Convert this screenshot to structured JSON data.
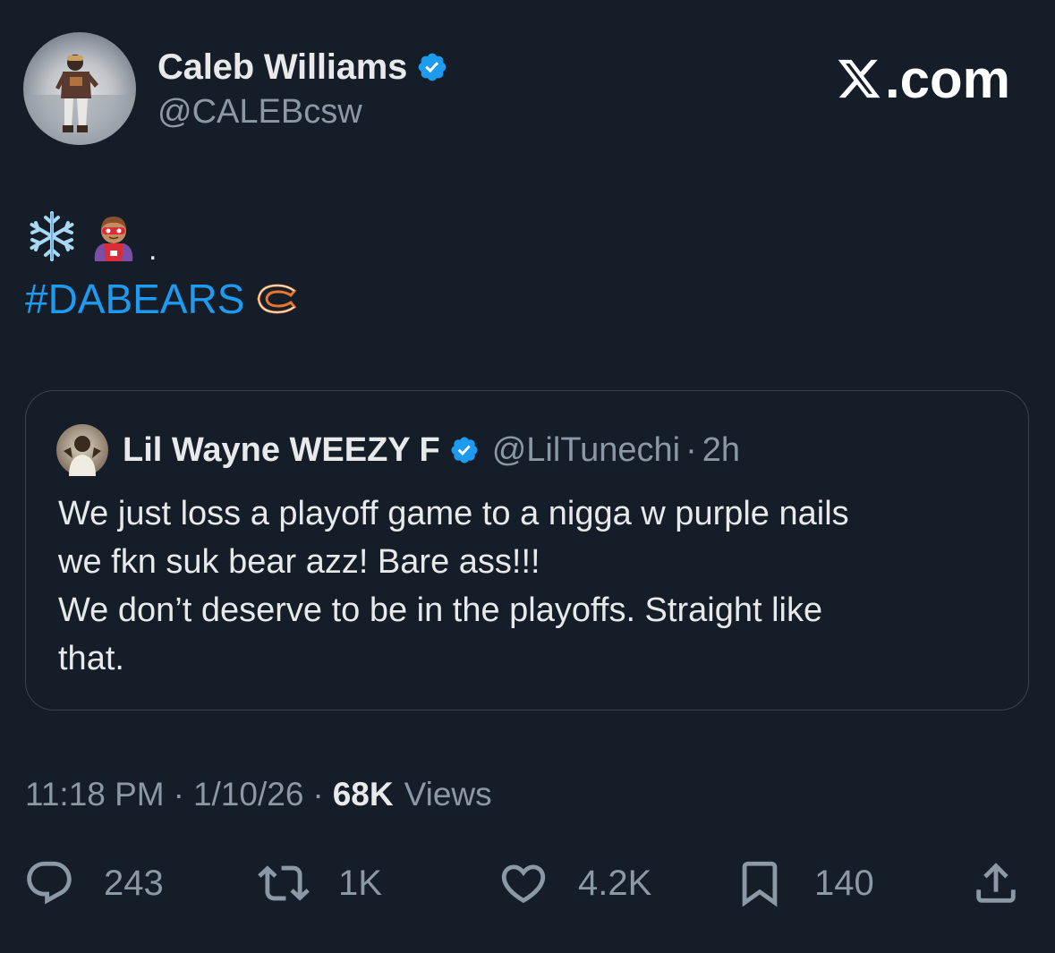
{
  "author": {
    "name": "Caleb Williams",
    "handle": "@CALEBcsw",
    "verified": true
  },
  "site_label": ".com",
  "tweet": {
    "emojis": [
      "snowflake",
      "superhero"
    ],
    "trailing_dot": ".",
    "hashtag": "#DABEARS"
  },
  "quote": {
    "name": "Lil Wayne WEEZY F",
    "handle": "@LilTunechi",
    "separator": "·",
    "time": "2h",
    "lines": [
      "We just loss a playoff game to a nigga w purple nails",
      "we fkn suk bear azz! Bare ass!!!",
      "We don’t deserve to be in the playoffs. Straight like",
      "that."
    ]
  },
  "meta": {
    "time": "11:18 PM",
    "separator": "·",
    "date": "1/10/26",
    "views_count": "68K",
    "views_label": "Views"
  },
  "actions": {
    "replies": "243",
    "reposts": "1K",
    "likes": "4.2K",
    "bookmarks": "140"
  },
  "colors": {
    "background": "#151d28",
    "accent": "#1d9bf0",
    "muted": "#8b98a5",
    "text": "#e7e9ea"
  }
}
